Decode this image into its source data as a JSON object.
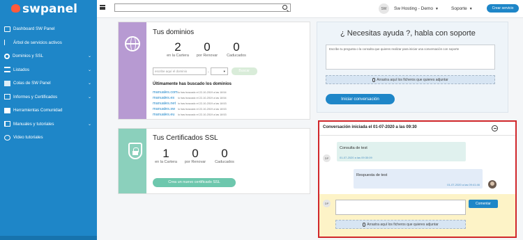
{
  "brand": {
    "name": "swpanel"
  },
  "sidebar": {
    "items": [
      {
        "label": "Dashboard SW Panel",
        "icon": "dashboard-icon"
      },
      {
        "label": "Árbol de servicios activos",
        "icon": "tree-icon"
      },
      {
        "label": "Dominios y SSL",
        "icon": "gear-icon",
        "expandable": true
      },
      {
        "label": "Listados",
        "icon": "list-icon",
        "expandable": true
      },
      {
        "label": "Colas de SW Panel",
        "icon": "stack-icon",
        "expandable": true
      },
      {
        "label": "Informes y Certificados",
        "icon": "certificate-icon",
        "expandable": true
      },
      {
        "label": "Herramientas Comunidad",
        "icon": "tools-icon"
      },
      {
        "label": "Manuales y tutoriales",
        "icon": "book-icon",
        "expandable": true
      },
      {
        "label": "Video tutoriales",
        "icon": "video-icon"
      }
    ]
  },
  "topbar": {
    "search_value": "",
    "avatar_initials": "SW",
    "account_label": "Sw Hosting - Demo",
    "support_label": "Soporte",
    "create_service_label": "Crear servicio"
  },
  "domains": {
    "title": "Tus dominios",
    "stats": [
      {
        "value": "2",
        "label": "en la Cartera"
      },
      {
        "value": "0",
        "label": "por Renovar"
      },
      {
        "value": "0",
        "label": "Caducados"
      }
    ],
    "search_placeholder": "escribe aquí el dominio",
    "search_button": "Buscar",
    "recent_title": "Últimamente has buscado los dominios",
    "recent": [
      {
        "domain": "manuales.com",
        "info": "lo has buscado el 22-10-2019 a las 18:54"
      },
      {
        "domain": "manuales.es",
        "info": "lo has buscado el 22-10-2019 a las 18:54"
      },
      {
        "domain": "manuales.net",
        "info": "lo has buscado el 22-10-2019 a las 18:53"
      },
      {
        "domain": "manuales.sw",
        "info": "lo has buscado el 22-10-2019 a las 18:53"
      },
      {
        "domain": "manuales.eu",
        "info": "lo has buscado el 22-10-2019 a las 18:53"
      }
    ]
  },
  "ssl": {
    "title": "Tus Certificados SSL",
    "stats": [
      {
        "value": "1",
        "label": "en la Cartera"
      },
      {
        "value": "0",
        "label": "por Renovar"
      },
      {
        "value": "0",
        "label": "Caducados"
      }
    ],
    "create_button": "Crea un nuevo certificado SSL"
  },
  "help": {
    "title": "¿ Necesitas ayuda ?, habla con soporte",
    "textarea_placeholder": "Escribe tu pregunta o la consulta que quieres realizar para iniciar una conversación con soporte",
    "attach_label": "Arrastra aquí los ficheros que quieres adjuntar",
    "start_button": "Iniciar conversación"
  },
  "conversation": {
    "title": "Conversación iniciada el 01-07-2020 a las 09:30",
    "messages": [
      {
        "author": "DP",
        "text": "Consulta de test",
        "time": "01-07-2020 a las 09:30:09"
      },
      {
        "author": "support",
        "text": "Respuesta de test",
        "time": "01-07-2020 a las 09:41:46"
      }
    ],
    "reply_author": "DP",
    "reply_value": "",
    "comment_button": "Comentar",
    "attach_label": "Arrastra aquí los ficheros que quieres adjuntar"
  },
  "colors": {
    "sidebar": "#1e86c8",
    "accent": "#1e86c8",
    "domains_band": "#b79ad2",
    "ssl_band": "#8bd0bc",
    "highlight_border": "#d0262a",
    "reply_bg": "#fdf3c7"
  }
}
